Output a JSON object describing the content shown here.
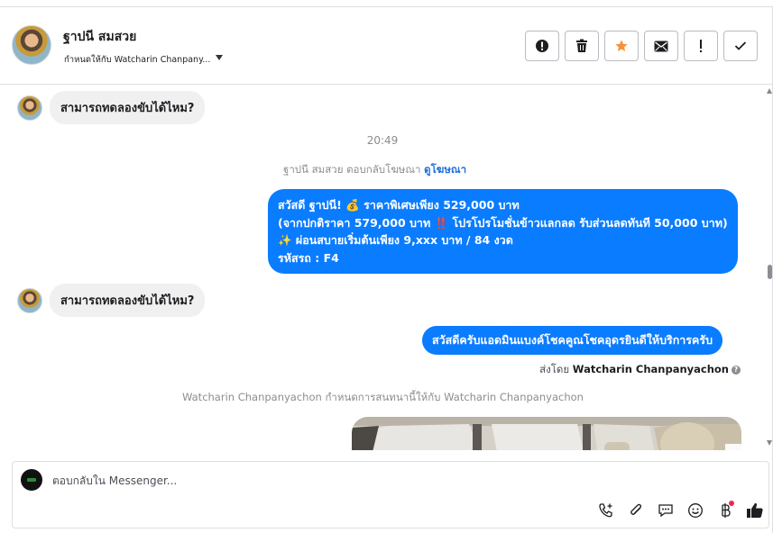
{
  "header": {
    "contact_name": "ฐาปนี สมสวย",
    "assign_label": "กำหนดให้กับ Watcharin Chanpany..."
  },
  "actions": [
    {
      "name": "spam-button",
      "icon": "alert-circle-icon"
    },
    {
      "name": "delete-button",
      "icon": "trash-icon"
    },
    {
      "name": "star-button",
      "icon": "star-icon",
      "color": "#f7923b"
    },
    {
      "name": "mark-unread-button",
      "icon": "envelope-icon"
    },
    {
      "name": "follow-up-button",
      "icon": "exclamation-icon"
    },
    {
      "name": "done-button",
      "icon": "check-icon"
    }
  ],
  "conversation": {
    "msg_in_1": "สามารถทดลองขับได้ไหม?",
    "timestamp": "20:49",
    "ad_reply_text": "ฐาปนี สมสวย ตอบกลับโฆษณา",
    "ad_link": "ดูโฆษณา",
    "msg_out_1": {
      "line1": "สวัสดี ฐาปนี! 💰 ราคาพิเศษเพียง 529,000 บาท",
      "line2": "(จากปกติราคา 579,000 บาท ‼️ โปรโปรโมชั่นข้าวแลกลด รับส่วนลดทันที 50,000 บาท)",
      "line3": "✨ ผ่อนสบายเริ่มต้นเพียง 9,xxx บาท / 84 งวด",
      "line4": "รหัสรถ : F4"
    },
    "msg_in_2": "สามารถทดลองขับได้ไหม?",
    "msg_out_2": "สวัสดีครับแอดมินแบงค์โชคคูณโชคอุดรยินดีให้บริการครับ",
    "sent_by_prefix": "ส่งโดย",
    "sent_by_name": "Watcharin Chanpanyachon",
    "assignment_note": "Watcharin Chanpanyachon กำหนดการสนทนานี้ให้กับ Watcharin Chanpanyachon"
  },
  "composer": {
    "placeholder": "ตอบกลับใน Messenger...",
    "value": ""
  },
  "colors": {
    "outgoing_bubble": "#0a7cff",
    "incoming_bubble": "#f0f0f0",
    "link": "#216fdb",
    "like": "#1c1e21"
  }
}
